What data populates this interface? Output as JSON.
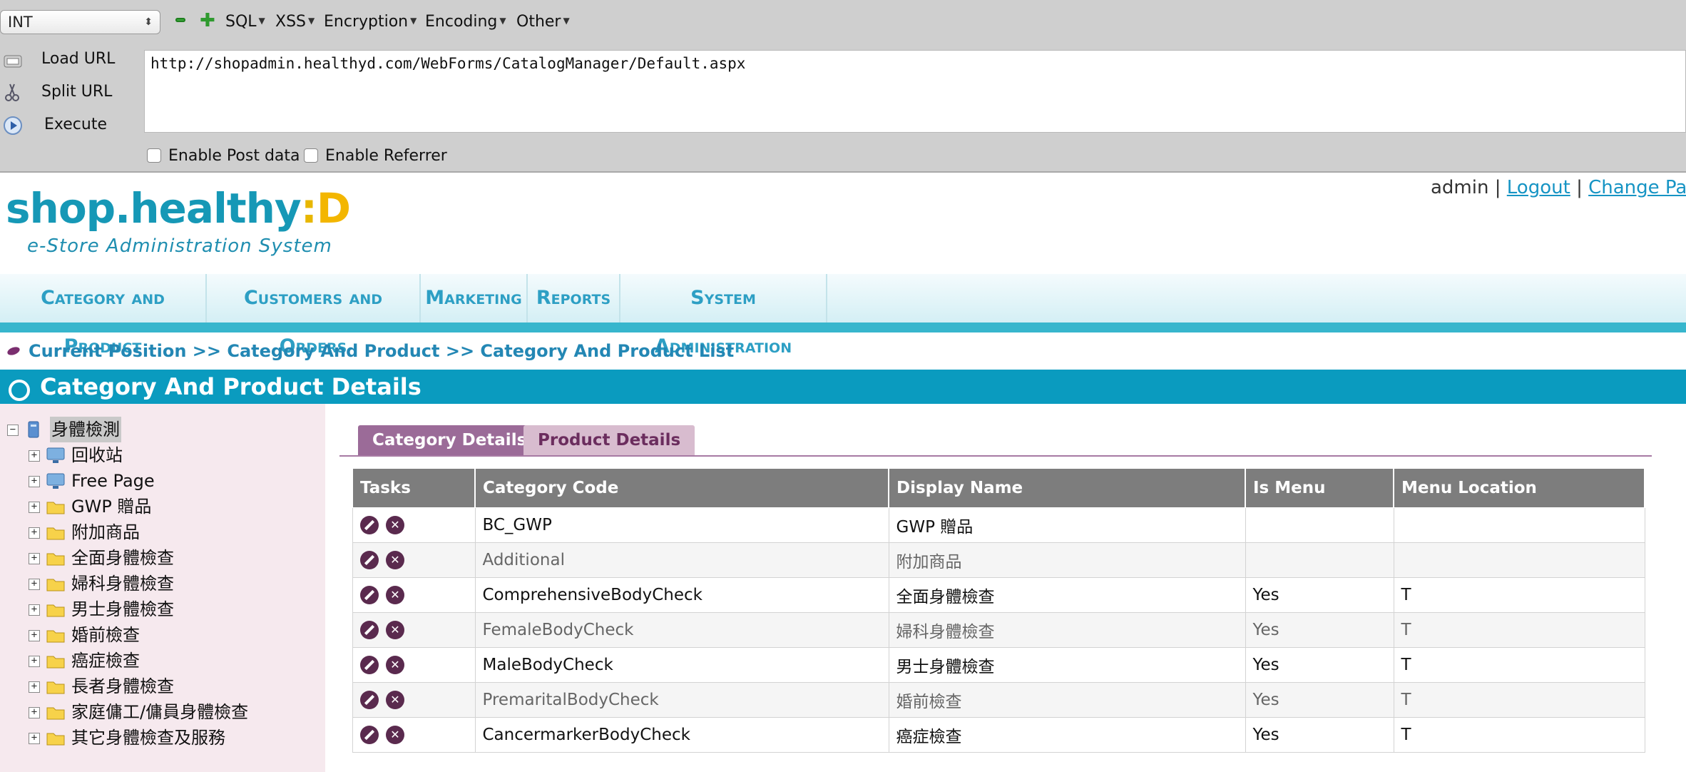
{
  "hackbar": {
    "select_value": "INT",
    "menu": [
      "SQL",
      "XSS",
      "Encryption",
      "Encoding",
      "Other"
    ],
    "actions": [
      "Load URL",
      "Split URL",
      "Execute"
    ],
    "url": "http://shopadmin.healthyd.com/WebForms/CatalogManager/Default.aspx",
    "checks": [
      "Enable Post data",
      "Enable Referrer"
    ]
  },
  "header": {
    "logo_main": "shop.healthy",
    "logo_colon": ":",
    "logo_d": "D",
    "logo_sub": "e-Store  Administration  System",
    "user": "admin",
    "sep": "|",
    "logout": "Logout",
    "change_password": "Change Passw"
  },
  "nav": [
    "Category and Product",
    "Customers and Orders",
    "Marketing",
    "Reports",
    "System Administration"
  ],
  "breadcrumb": "Current Position >> Category And Product >> Category And Product List",
  "page_title": "Category And Product Details",
  "tree": {
    "root": "身體檢測",
    "items": [
      "回收站",
      "Free Page",
      "GWP 贈品",
      "附加商品",
      "全面身體檢查",
      "婦科身體檢查",
      "男士身體檢查",
      "婚前檢查",
      "癌症檢查",
      "長者身體檢查",
      "家庭傭工/傭員身體檢查",
      "其它身體檢查及服務"
    ]
  },
  "tabs": [
    "Category Details",
    "Product Details"
  ],
  "table": {
    "headers": [
      "Tasks",
      "Category Code",
      "Display Name",
      "Is Menu",
      "Menu Location"
    ],
    "rows": [
      [
        "BC_GWP",
        "GWP 贈品",
        "",
        ""
      ],
      [
        "Additional",
        "附加商品",
        "",
        ""
      ],
      [
        "ComprehensiveBodyCheck",
        "全面身體檢查",
        "Yes",
        "T"
      ],
      [
        "FemaleBodyCheck",
        "婦科身體檢查",
        "Yes",
        "T"
      ],
      [
        "MaleBodyCheck",
        "男士身體檢查",
        "Yes",
        "T"
      ],
      [
        "PremaritalBodyCheck",
        "婚前檢查",
        "Yes",
        "T"
      ],
      [
        "CancermarkerBodyCheck",
        "癌症檢查",
        "Yes",
        "T"
      ]
    ]
  },
  "colors": {
    "accent": "#0a9bbf",
    "nav_text": "#2d9fc4",
    "tab_active": "#9b6b98",
    "tab_inactive": "#d8bccf",
    "table_header": "#7d7d7d"
  }
}
